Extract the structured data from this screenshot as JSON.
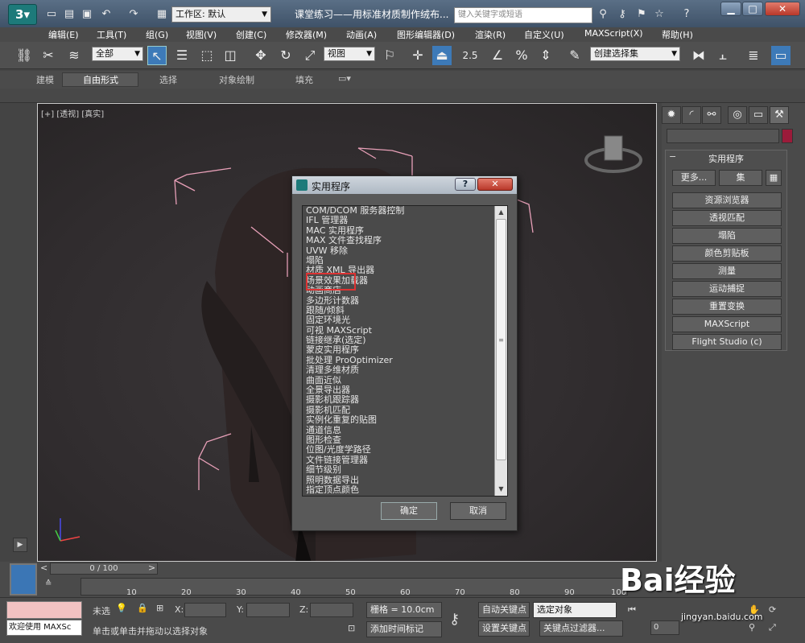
{
  "titlebar": {
    "workspace": "工作区: 默认",
    "title": "课堂练习——用标准材质制作绒布...",
    "search_placeholder": "键入关键字或短语",
    "minimize": "▁",
    "maximize": "□",
    "close": "✕"
  },
  "menu": [
    "编辑(E)",
    "工具(T)",
    "组(G)",
    "视图(V)",
    "创建(C)",
    "修改器(M)",
    "动画(A)",
    "图形编辑器(D)",
    "渲染(R)",
    "自定义(U)",
    "MAXScript(X)",
    "帮助(H)"
  ],
  "toolbar": {
    "filter": "全部",
    "ref_coord": "视图",
    "snap_number": "2.5",
    "selection_set": "创建选择集"
  },
  "ribbon": {
    "tabs": [
      "建模",
      "自由形式",
      "选择",
      "对象绘制",
      "填充"
    ]
  },
  "viewport": {
    "label": "[+] [透视] [真实]"
  },
  "dialog": {
    "title": "实用程序",
    "help": "?",
    "close": "✕",
    "items": [
      "COM/DCOM 服务器控制",
      "IFL 管理器",
      "MAC 实用程序",
      "MAX 文件查找程序",
      "UVW 移除",
      "塌陷",
      "材质 XML 导出器",
      "场景效果加载器",
      "动画商店",
      "多边形计数器",
      "跟随/倾斜",
      "固定环境光",
      "可视 MAXScript",
      "链接继承(选定)",
      "蒙皮实用程序",
      "批处理 ProOptimizer",
      "清理多维材质",
      "曲面近似",
      "全景导出器",
      "摄影机跟踪器",
      "摄影机匹配",
      "实例化重复的贴图",
      "通道信息",
      "图形检查",
      "位图/光度学路径",
      "文件链接管理器",
      "细节级别",
      "照明数据导出",
      "指定顶点颜色"
    ],
    "ok": "确定",
    "cancel": "取消"
  },
  "command_panel": {
    "rollout_title": "实用程序",
    "more": "更多...",
    "sets": "集",
    "buttons": [
      "资源浏览器",
      "透视匹配",
      "塌陷",
      "颜色剪贴板",
      "测量",
      "运动捕捉",
      "重置变换",
      "MAXScript",
      "Flight Studio (c)"
    ]
  },
  "timeline": {
    "slider": "0 / 100",
    "ticks": [
      "10",
      "20",
      "30",
      "40",
      "50",
      "60",
      "70",
      "80",
      "90",
      "100"
    ]
  },
  "status": {
    "maxscript_text": "欢迎使用 MAXSc",
    "not_selected": "未选",
    "x_label": "X:",
    "y_label": "Y:",
    "z_label": "Z:",
    "grid": "栅格 = 10.0cm",
    "prompt": "单击或单击并拖动以选择对象",
    "add_time_tag": "添加时间标记",
    "auto_key": "自动关键点",
    "set_key": "设置关键点",
    "selected_object": "选定对象",
    "key_filters": "关键点过滤器...",
    "frame": "0"
  },
  "watermark": {
    "text": "Bai经验",
    "url": "jingyan.baidu.com"
  },
  "colors": {
    "highlight": "#dd3333",
    "accent_blue": "#3b76b5",
    "object_color": "#9b1b3a",
    "bounding_box": "#e8a0b8"
  }
}
